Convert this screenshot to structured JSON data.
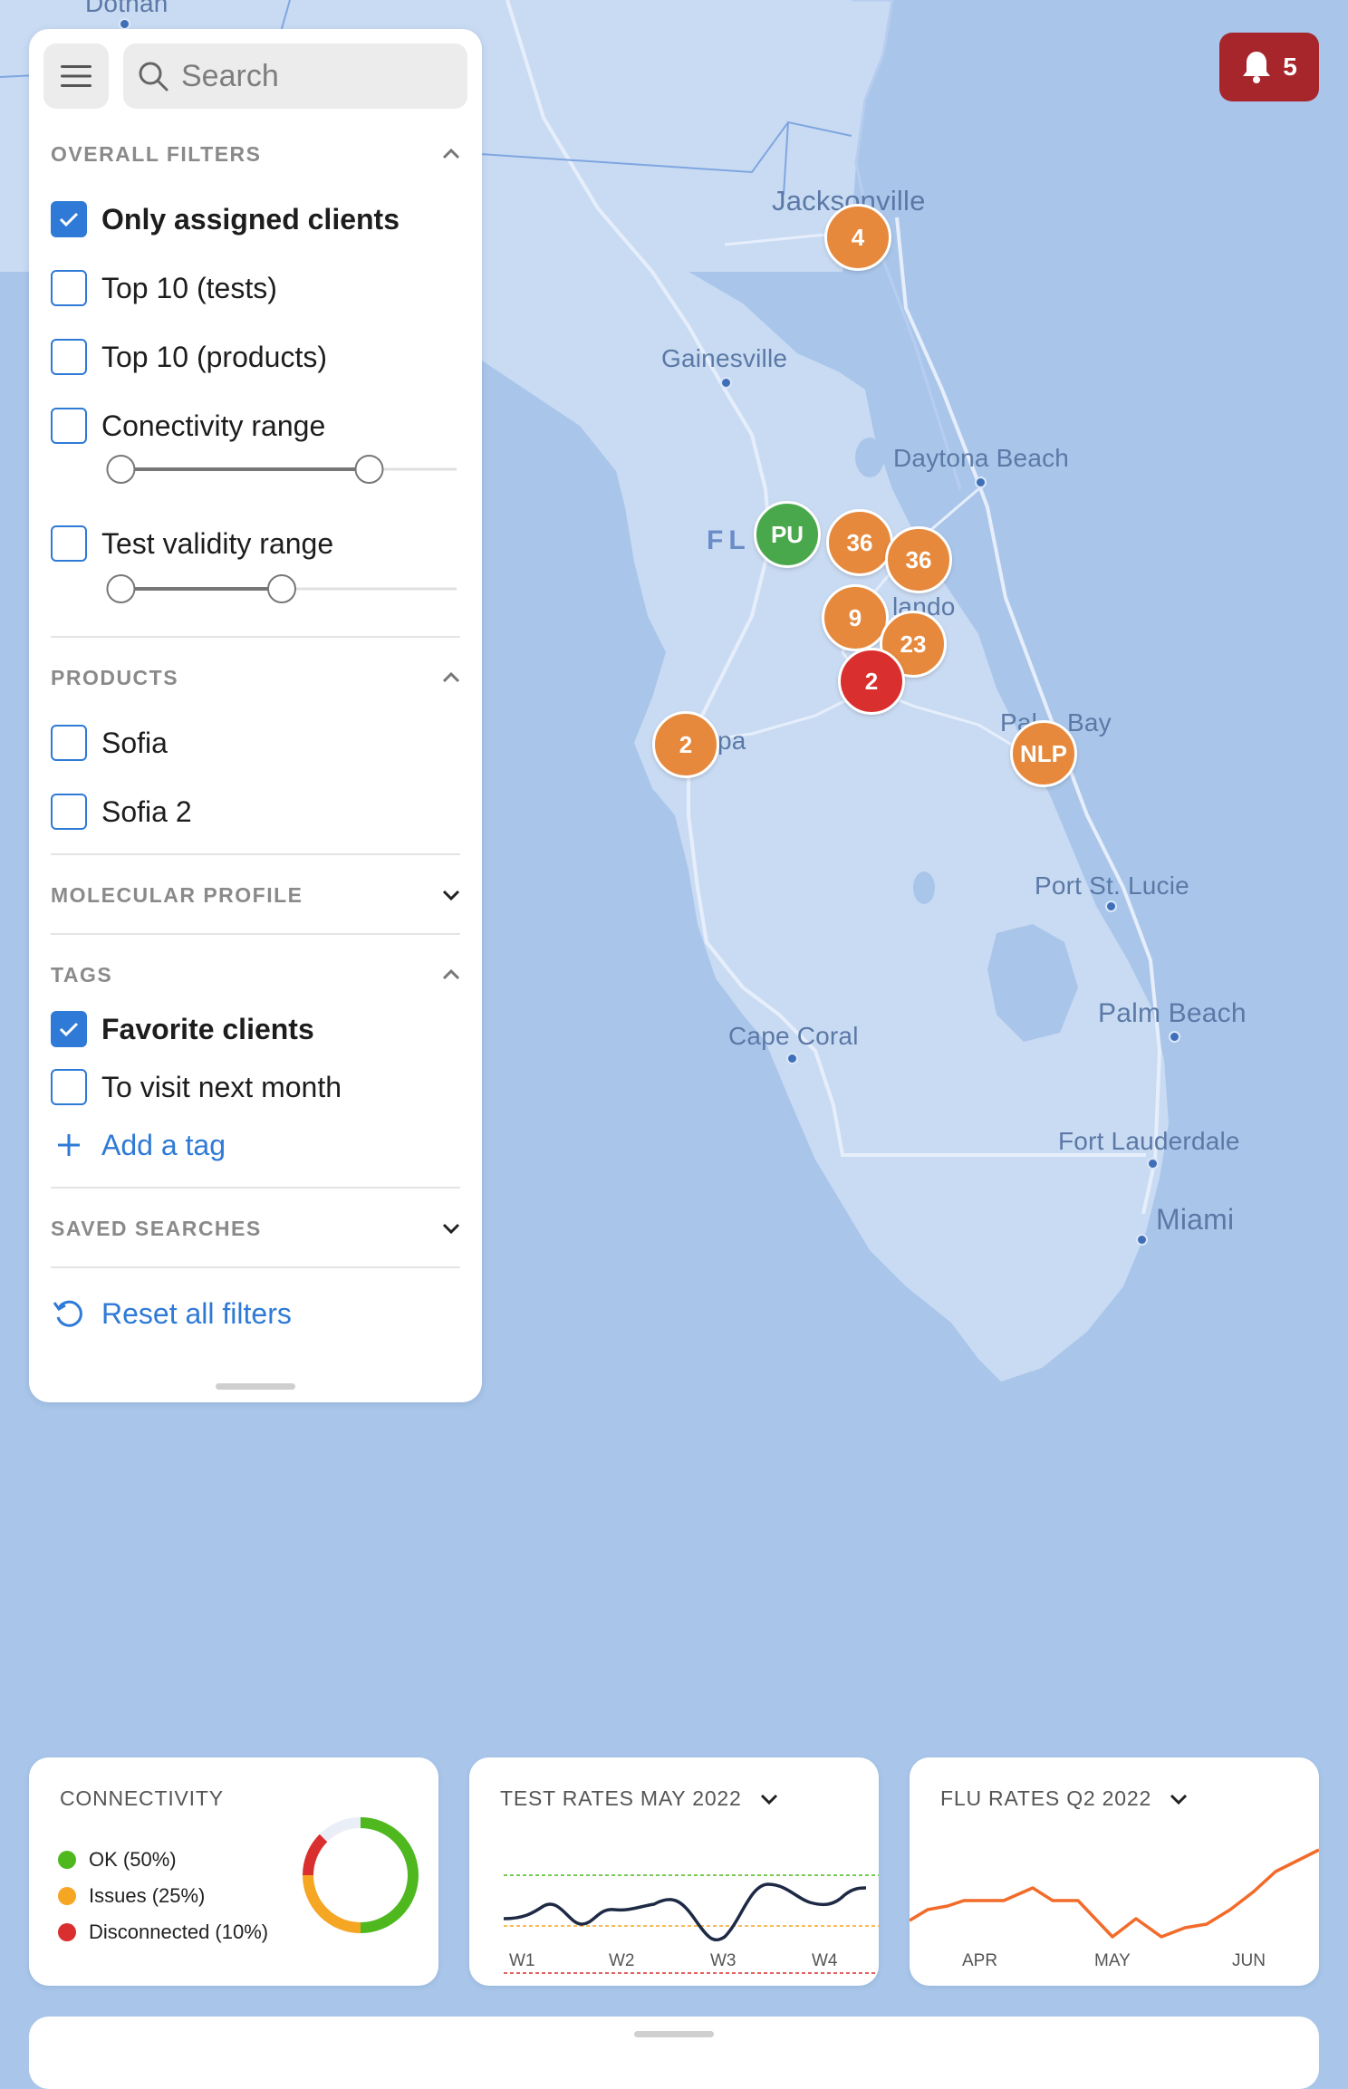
{
  "map": {
    "cities": [
      {
        "name": "Dothan"
      },
      {
        "name": "Jacksonville"
      },
      {
        "name": "Gainesville"
      },
      {
        "name": "Daytona Beach"
      },
      {
        "name": "FL"
      },
      {
        "name": "lando"
      },
      {
        "name": "pa"
      },
      {
        "name": "Pal"
      },
      {
        "name": "Bay"
      },
      {
        "name": "Port St. Lucie"
      },
      {
        "name": "Palm Beach"
      },
      {
        "name": "Cape Coral"
      },
      {
        "name": "Fort Lauderdale"
      },
      {
        "name": "Miami"
      }
    ],
    "markers": [
      {
        "label": "4",
        "status": "orange"
      },
      {
        "label": "PU",
        "status": "green"
      },
      {
        "label": "36",
        "status": "orange"
      },
      {
        "label": "36",
        "status": "orange"
      },
      {
        "label": "9",
        "status": "orange"
      },
      {
        "label": "23",
        "status": "orange"
      },
      {
        "label": "2",
        "status": "red"
      },
      {
        "label": "2",
        "status": "orange"
      },
      {
        "label": "NLP",
        "status": "orange"
      }
    ],
    "colors": {
      "orange": "#e6893d",
      "green": "#4aa84c",
      "red": "#d9302f"
    }
  },
  "notifications": {
    "icon": "bell-icon",
    "count": "5",
    "color": "#a6262c"
  },
  "panel": {
    "search_placeholder": "Search",
    "overall_filters": {
      "title": "OVERALL FILTERS",
      "items": [
        {
          "label": "Only assigned clients",
          "checked": true
        },
        {
          "label": "Top 10 (tests)",
          "checked": false
        },
        {
          "label": "Top 10 (products)",
          "checked": false
        },
        {
          "label": "Conectivity range",
          "checked": false
        },
        {
          "label": "Test validity range",
          "checked": false
        }
      ],
      "connectivity_range": [
        0.04,
        0.75
      ],
      "validity_range": [
        0.04,
        0.5
      ]
    },
    "products": {
      "title": "PRODUCTS",
      "items": [
        {
          "label": "Sofia",
          "checked": false
        },
        {
          "label": "Sofia 2",
          "checked": false
        }
      ]
    },
    "molecular_profile": {
      "title": "MOLECULAR PROFILE"
    },
    "tags": {
      "title": "TAGS",
      "items": [
        {
          "label": "Favorite clients",
          "checked": true
        },
        {
          "label": "To visit next month",
          "checked": false
        }
      ],
      "add_label": "Add a tag"
    },
    "saved_searches": {
      "title": "SAVED SEARCHES"
    },
    "reset_label": "Reset all filters",
    "accent": "#2e7ad6"
  },
  "cards": {
    "connectivity": {
      "title": "CONNECTIVITY",
      "legend": [
        {
          "label": "OK (50%)",
          "color": "#4fb81f"
        },
        {
          "label": "Issues (25%)",
          "color": "#f5a623"
        },
        {
          "label": "Disconnected (10%)",
          "color": "#d9302f"
        }
      ]
    },
    "test_rates": {
      "title": "TEST RATES MAY 2022",
      "ticks": [
        "W1",
        "W2",
        "W3",
        "W4"
      ]
    },
    "flu_rates": {
      "title": "FLU RATES Q2 2022",
      "ticks": [
        "APR",
        "MAY",
        "JUN"
      ],
      "color": "#f26b2a"
    }
  }
}
